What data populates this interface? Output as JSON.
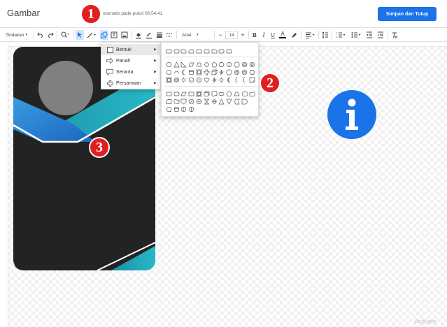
{
  "header": {
    "title": "Gambar",
    "autosave": "otomatis pada pukul 06.54.41",
    "save_button": "Simpan dan Tutup"
  },
  "toolbar": {
    "actions": "Tindakan",
    "font": "Arial",
    "font_size": "14"
  },
  "shape_menu": {
    "items": [
      {
        "label": "Bentuk",
        "icon": "square-icon"
      },
      {
        "label": "Panah",
        "icon": "arrow-icon"
      },
      {
        "label": "Seranta",
        "icon": "callout-icon"
      },
      {
        "label": "Persamaan",
        "icon": "plus-icon"
      }
    ],
    "highlighted": "Bentuk"
  },
  "callouts": [
    "1",
    "2",
    "3"
  ],
  "watermark": "Activate",
  "colors": {
    "accent": "#1a73e8",
    "callout": "#e02020",
    "card_dark": "#222222",
    "card_teal": "#1fa3b5",
    "info_blue": "#1a73e8"
  }
}
